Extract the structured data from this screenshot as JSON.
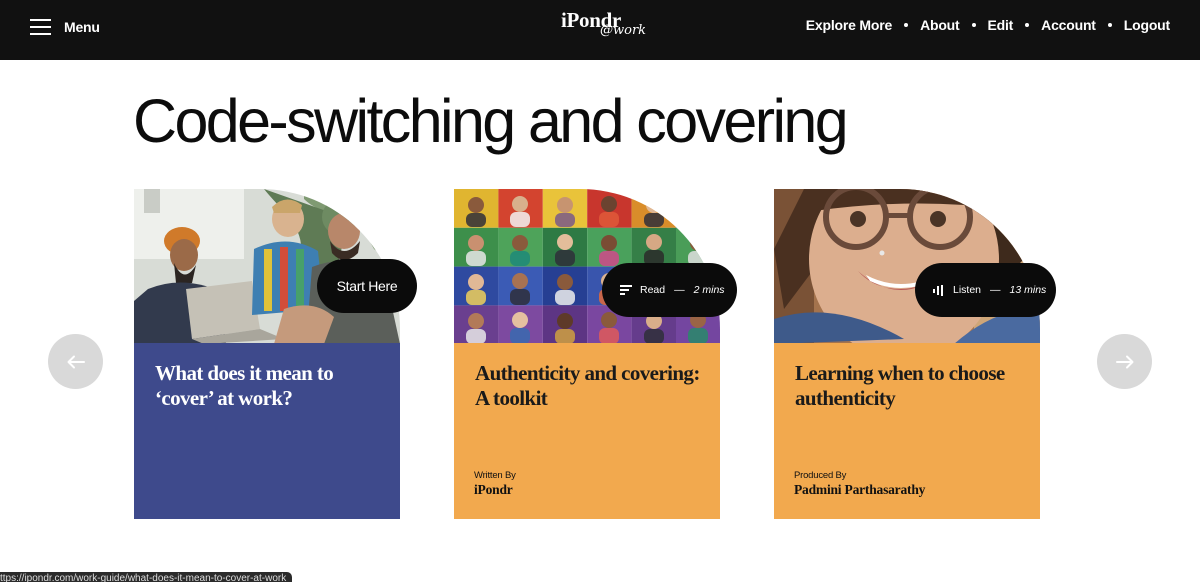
{
  "nav": {
    "menu_label": "Menu",
    "logo_main": "iPondr",
    "logo_sub": "@work",
    "links": [
      "Explore More",
      "About",
      "Edit",
      "Account",
      "Logout"
    ]
  },
  "page": {
    "title": "Code-switching and covering"
  },
  "cards": [
    {
      "title": "What does it mean to ‘cover’ at work?",
      "cta": "Start Here",
      "panel_color": "#3e4a8c"
    },
    {
      "title": "Authenticity and covering: A toolkit",
      "media_type": "Read",
      "duration": "2 mins",
      "credit_label": "Written By",
      "credit_name": "iPondr",
      "panel_color": "#f2a94e"
    },
    {
      "title": "Learning when to choose authenticity",
      "media_type": "Listen",
      "duration": "13 mins",
      "credit_label": "Produced By",
      "credit_name": "Padmini Parthasarathy",
      "panel_color": "#f2a94e"
    }
  ],
  "status_bar": {
    "url": "ttps://ipondr.com/work-guide/what-does-it-mean-to-cover-at-work"
  },
  "icons": [
    "hamburger-icon",
    "arrow-left-icon",
    "arrow-right-icon",
    "text-lines-icon",
    "audio-bars-icon"
  ],
  "colors": {
    "nav_bg": "#111111",
    "blue_panel": "#3e4a8c",
    "orange_panel": "#f2a94e",
    "arrow_bg": "#d9d9d9"
  }
}
